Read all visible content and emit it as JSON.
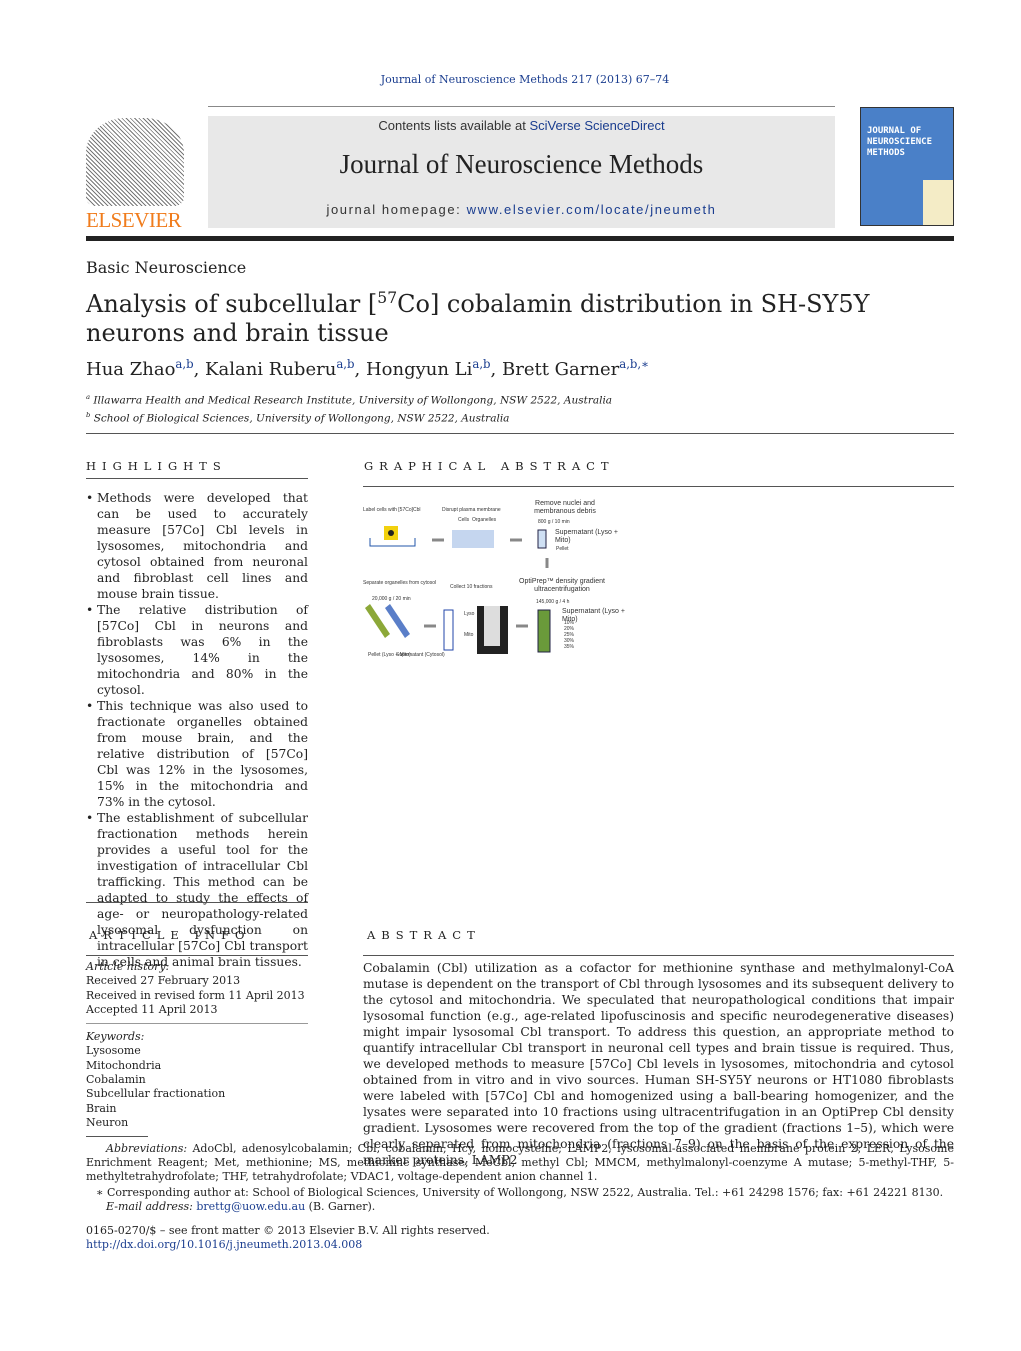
{
  "header": {
    "citation": "Journal of Neuroscience Methods 217 (2013) 67–74",
    "contents_prefix": "Contents lists available at ",
    "contents_link": "SciVerse ScienceDirect",
    "journal_title": "Journal of Neuroscience Methods",
    "homepage_prefix": "journal homepage: ",
    "homepage_link": "www.elsevier.com/locate/jneumeth",
    "publisher_logo": "ELSEVIER",
    "cover_title": "JOURNAL OF NEUROSCIENCE METHODS"
  },
  "article": {
    "section": "Basic Neuroscience",
    "title_pre": "Analysis of subcellular [",
    "title_sup": "57",
    "title_post": "Co] cobalamin distribution in SH-SY5Y neurons and brain tissue",
    "authors": [
      {
        "name": "Hua Zhao",
        "sup": "a,b"
      },
      {
        "name": "Kalani Ruberu",
        "sup": "a,b"
      },
      {
        "name": "Hongyun Li",
        "sup": "a,b"
      },
      {
        "name": "Brett Garner",
        "sup": "a,b,∗"
      }
    ],
    "affiliations": [
      {
        "mark": "a",
        "text": "Illawarra Health and Medical Research Institute, University of Wollongong, NSW 2522, Australia"
      },
      {
        "mark": "b",
        "text": "School of Biological Sciences, University of Wollongong, NSW 2522, Australia"
      }
    ]
  },
  "highlights": {
    "heading": "HIGHLIGHTS",
    "items": [
      "Methods were developed that can be used to accurately measure [57Co] Cbl levels in lysosomes, mitochondria and cytosol obtained from neuronal and fibroblast cell lines and mouse brain tissue.",
      "The relative distribution of [57Co] Cbl in neurons and fibroblasts was 6% in the lysosomes, 14% in the mitochondria and 80% in the cytosol.",
      "This technique was also used to fractionate organelles obtained from mouse brain, and the relative distribution of [57Co] Cbl was 12% in the lysosomes, 15% in the mitochondria and 73% in the cytosol.",
      "The establishment of subcellular fractionation methods herein provides a useful tool for the investigation of intracellular Cbl trafficking. This method can be adapted to study the effects of age- or neuropathology-related lysosomal dysfunction on intracellular [57Co] Cbl transport in cells and animal brain tissues."
    ]
  },
  "graphical_abstract": {
    "heading": "GRAPHICAL ABSTRACT",
    "labels": {
      "step1": "Label cells with [57Co]Cbl",
      "step2": "Disrupt plasma membrane",
      "cells": "Cells",
      "organelles": "Organelles",
      "step3": "Remove nuclei and membranous debris",
      "spin1": "800 g / 10 min",
      "supernatant1": "Supernatant (Lyso + Mito)",
      "pellet1": "Pellet",
      "step4": "OptiPrep™ density gradient ultracentrifugation",
      "spin2": "145,000 g / 4 h",
      "supernatant2": "Supernatant (Lyso + Mito)",
      "gradient": [
        "10%",
        "20%",
        "25%",
        "30%",
        "35%"
      ],
      "step5": "Collect 10 fractions",
      "lyso": "Lyso",
      "mito": "Mito",
      "step6": "Separate organelles from cytosol",
      "spin3": "20,000 g / 20 min",
      "pellet2": "Pellet (Lyso + Mito)",
      "supernatant3": "Supernatant (Cytosol)"
    }
  },
  "article_info": {
    "heading": "ARTICLE INFO",
    "history_label": "Article history:",
    "history": [
      "Received 27 February 2013",
      "Received in revised form 11 April 2013",
      "Accepted 11 April 2013"
    ],
    "keywords_label": "Keywords:",
    "keywords": [
      "Lysosome",
      "Mitochondria",
      "Cobalamin",
      "Subcellular fractionation",
      "Brain",
      "Neuron"
    ]
  },
  "abstract": {
    "heading": "ABSTRACT",
    "text": "Cobalamin (Cbl) utilization as a cofactor for methionine synthase and methylmalonyl-CoA mutase is dependent on the transport of Cbl through lysosomes and its subsequent delivery to the cytosol and mitochondria. We speculated that neuropathological conditions that impair lysosomal function (e.g., age-related lipofuscinosis and specific neurodegenerative diseases) might impair lysosomal Cbl transport. To address this question, an appropriate method to quantify intracellular Cbl transport in neuronal cell types and brain tissue is required. Thus, we developed methods to measure [57Co] Cbl levels in lysosomes, mitochondria and cytosol obtained from in vitro and in vivo sources. Human SH-SY5Y neurons or HT1080 fibroblasts were labeled with [57Co] Cbl and homogenized using a ball-bearing homogenizer, and the lysates were separated into 10 fractions using ultracentrifugation in an OptiPrep Cbl density gradient. Lysosomes were recovered from the top of the gradient (fractions 1–5), which were clearly separated from mitochondria (fractions 7–9) on the basis of the expression of the marker proteins, LAMP2"
  },
  "footnotes": {
    "abbreviations_label": "Abbreviations:",
    "abbreviations": "AdoCbl, adenosylcobalamin; Cbl, cobalamin; Hcy, homocysteine; LAMP2, lysosomal-associated membrane protein 2; LER, Lysosome Enrichment Reagent; Met, methionine; MS, methionine synthase; MeCbl, methyl Cbl; MMCM, methylmalonyl-coenzyme A mutase; 5-methyl-THF, 5-methyltetrahydrofolate; THF, tetrahydrofolate; VDAC1, voltage-dependent anion channel 1.",
    "corresponding": "∗ Corresponding author at: School of Biological Sciences, University of Wollongong, NSW 2522, Australia. Tel.: +61 24298 1576; fax: +61 24221 8130.",
    "email_label": "E-mail address: ",
    "email": "brettg@uow.edu.au",
    "email_suffix": " (B. Garner).",
    "copyright": "0165-0270/$ – see front matter © 2013 Elsevier B.V. All rights reserved.",
    "doi": "http://dx.doi.org/10.1016/j.jneumeth.2013.04.008"
  }
}
